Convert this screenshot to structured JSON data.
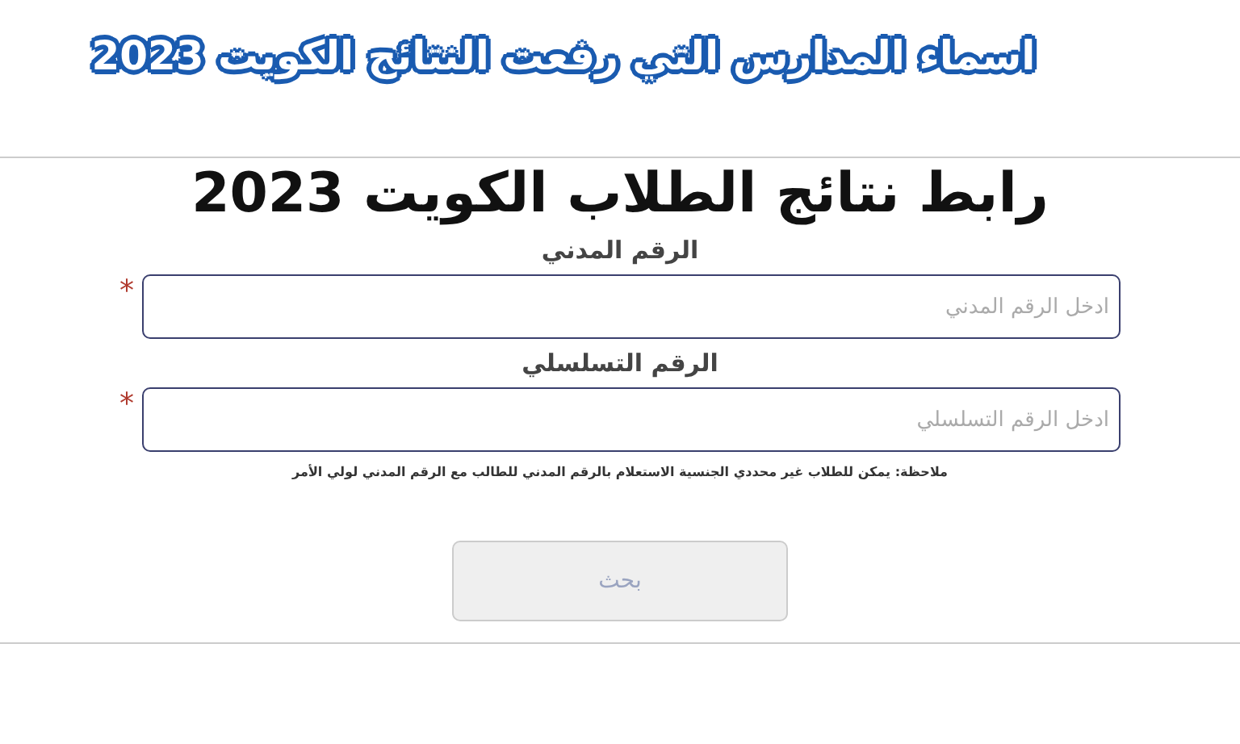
{
  "banner": {
    "title": "اسماء المدارس التي رفعت النتائج الكويت 2023"
  },
  "form": {
    "heading": "رابط نتائج الطلاب الكويت 2023",
    "fields": [
      {
        "label": "الرقم المدني",
        "placeholder": "ادخل الرقم المدني",
        "required_mark": "*"
      },
      {
        "label": "الرقم التسلسلي",
        "placeholder": "ادخل الرقم التسلسلي",
        "required_mark": "*"
      }
    ],
    "note": "ملاحظة: يمكن للطلاب غير محددي الجنسية الاستعلام بالرقم المدني للطالب مع الرقم المدني لولي الأمر",
    "submit": "بحث"
  }
}
